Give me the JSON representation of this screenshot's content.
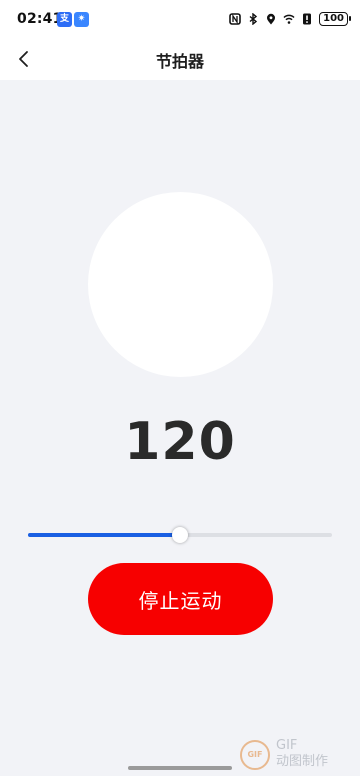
{
  "status_bar": {
    "time": "02:41",
    "app_badges": [
      "支",
      "✷"
    ],
    "battery": "100"
  },
  "header": {
    "title": "节拍器",
    "back_icon": "chevron-left-icon"
  },
  "metronome": {
    "bpm": "120",
    "tempo_fraction": 0.5,
    "stop_label": "停止运动"
  },
  "watermark": {
    "logo_text": "GIF",
    "line1": "GIF",
    "line2": "动图制作"
  },
  "colors": {
    "accent": "#1a5fe3",
    "stop_button": "#f70000",
    "background": "#f2f3f7"
  }
}
